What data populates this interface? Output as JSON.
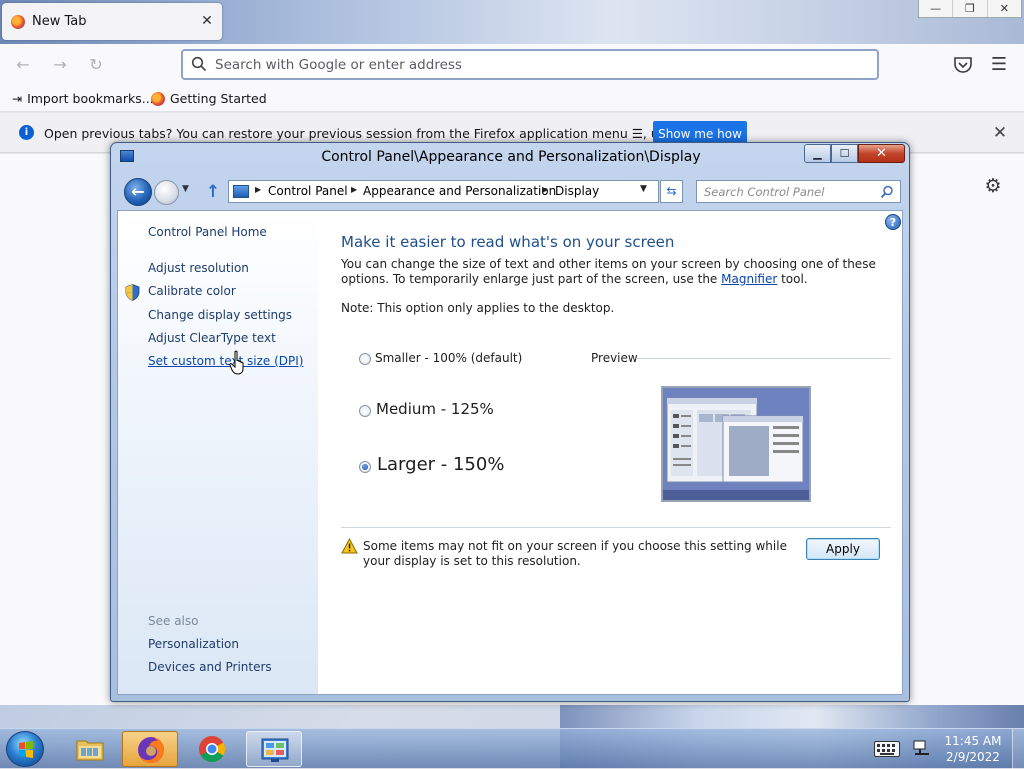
{
  "firefox": {
    "tab": {
      "title": "New Tab"
    },
    "window_controls": {
      "minimize": "—",
      "restore": "❐",
      "close": "✕"
    },
    "urlbar": {
      "placeholder": "Search with Google or enter address"
    },
    "bookmarks": [
      {
        "label": "Import bookmarks...",
        "icon": "import-icon"
      },
      {
        "label": "Getting Started",
        "icon": "firefox-icon"
      }
    ],
    "infobar": {
      "text": "Open previous tabs? You can restore your previous session from the Firefox application menu ☰, under History.",
      "button": "Show me how"
    }
  },
  "control_panel": {
    "title": "Control Panel\\Appearance and Personalization\\Display",
    "breadcrumbs": [
      "Control Panel",
      "Appearance and Personalization",
      "Display"
    ],
    "search_placeholder": "Search Control Panel",
    "sidebar": {
      "home": "Control Panel Home",
      "links": [
        "Adjust resolution",
        "Calibrate color",
        "Change display settings",
        "Adjust ClearType text",
        "Set custom text size (DPI)"
      ],
      "see_also_label": "See also",
      "see_also": [
        "Personalization",
        "Devices and Printers"
      ]
    },
    "main": {
      "heading": "Make it easier to read what's on your screen",
      "description_part1": "You can change the size of text and other items on your screen by choosing one of these options. To temporarily enlarge just part of the screen, use the ",
      "magnifier_link": "Magnifier",
      "description_part2": " tool.",
      "note": "Note: This option only applies to the desktop.",
      "options": [
        {
          "label": "Smaller - 100% (default)",
          "selected": false
        },
        {
          "label": "Medium - 125%",
          "selected": false
        },
        {
          "label": "Larger - 150%",
          "selected": true
        }
      ],
      "preview_label": "Preview",
      "warning": "Some items may not fit on your screen if you choose this setting while your display is set to this resolution.",
      "apply": "Apply"
    }
  },
  "taskbar": {
    "items": [
      {
        "name": "windows-explorer",
        "state": "normal"
      },
      {
        "name": "firefox",
        "state": "active"
      },
      {
        "name": "chrome",
        "state": "normal"
      },
      {
        "name": "control-panel",
        "state": "open"
      }
    ],
    "clock": {
      "time": "11:45 AM",
      "date": "2/9/2022"
    }
  },
  "colors": {
    "heading_blue": "#1e4e8c",
    "link_blue": "#0645ad",
    "firefox_button": "#1a73e8"
  }
}
